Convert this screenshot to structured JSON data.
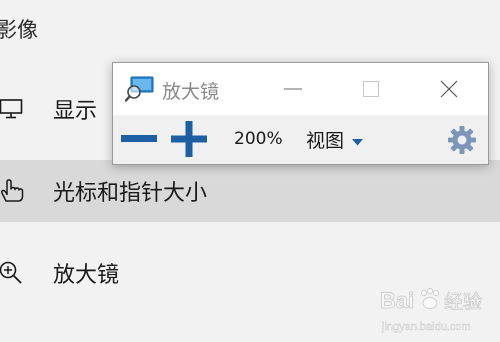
{
  "settings": {
    "section_header": "影像",
    "nav_items": [
      {
        "label": "显示",
        "icon": "monitor-icon"
      },
      {
        "label": "光标和指针大小",
        "icon": "pointer-hand-icon",
        "selected": true
      },
      {
        "label": "放大镜",
        "icon": "magnifier-zoom-icon"
      }
    ]
  },
  "magnifier": {
    "title": "放大镜",
    "app_icon": "magnifier-app-icon",
    "zoom_level": "200%",
    "views_label": "视图",
    "buttons": {
      "zoom_out": "minus-icon",
      "zoom_in": "plus-icon",
      "settings": "gear-icon",
      "minimize": "minimize-icon",
      "maximize": "maximize-icon",
      "close": "close-icon"
    },
    "colors": {
      "accent": "#1e5fa3",
      "title_text": "#8a8a8a",
      "toolbar_bg": "#f0f0f0",
      "gear": "#7a96b8"
    }
  },
  "watermark": {
    "text": "Baidu 经验",
    "subtext": "jingyan.baidu.com"
  }
}
